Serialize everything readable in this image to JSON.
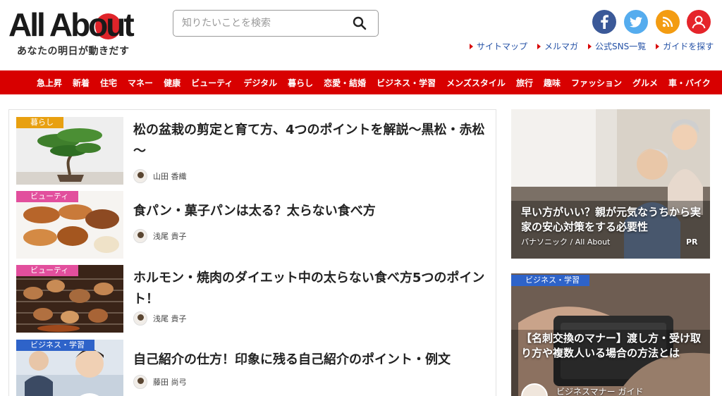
{
  "header": {
    "logo": "All About",
    "tagline": "あなたの明日が動きだす",
    "search_placeholder": "知りたいことを検索",
    "social": {
      "facebook_color": "#3b5998",
      "twitter_color": "#55acee",
      "rss_color": "#f39c12",
      "user_color": "#e5242a"
    },
    "sub_links": [
      "サイトマップ",
      "メルマガ",
      "公式SNS一覧",
      "ガイドを探す"
    ]
  },
  "nav": {
    "color": "#d80000",
    "items": [
      "急上昇",
      "新着",
      "住宅",
      "マネー",
      "健康",
      "ビューティ",
      "デジタル",
      "暮らし",
      "恋愛・結婚",
      "ビジネス・学習",
      "メンズスタイル",
      "旅行",
      "趣味",
      "ファッション",
      "グルメ",
      "車・バイク"
    ]
  },
  "articles": [
    {
      "category": "暮らし",
      "category_color": "#e8a010",
      "title": "松の盆栽の剪定と育て方、4つのポイントを解説～黒松・赤松～",
      "author": "山田 香織",
      "thumb": "bonsai"
    },
    {
      "category": "ビューティ",
      "category_color": "#e24f9d",
      "title": "食パン・菓子パンは太る？太らない食べ方",
      "author": "浅尾 貴子",
      "thumb": "bread"
    },
    {
      "category": "ビューティ",
      "category_color": "#e24f9d",
      "title": "ホルモン・焼肉のダイエット中の太らない食べ方5つのポイント！",
      "author": "浅尾 貴子",
      "thumb": "grill"
    },
    {
      "category": "ビジネス・学習",
      "category_color": "#2e63c9",
      "title": "自己紹介の仕方！印象に残る自己紹介のポイント・例文",
      "author": "藤田 尚弓",
      "thumb": "office"
    }
  ],
  "sidebar": {
    "pr_card": {
      "title": "早い方がいい？親が元気なうちから実家の安心対策をする必要性",
      "sponsor": "パナソニック / All About",
      "pr": "PR"
    },
    "feature_card": {
      "category": "ビジネス・学習",
      "category_color": "#2e63c9",
      "title": "【名刺交換のマナー】渡し方・受け取り方や複数人いる場合の方法とは",
      "guide": "ビジネスマナー ガイド"
    }
  }
}
